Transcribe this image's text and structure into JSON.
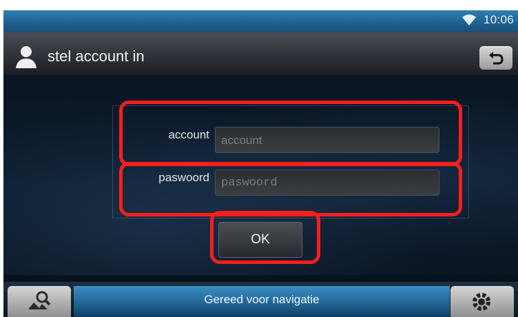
{
  "status": {
    "time": "10:06",
    "icon": "wifi-icon"
  },
  "header": {
    "title": "stel account in",
    "user_icon": "user-icon",
    "back_icon": "back-icon"
  },
  "form": {
    "account": {
      "label": "account",
      "placeholder": "account",
      "value": ""
    },
    "password": {
      "label": "paswoord",
      "placeholder": "paswoord",
      "value": ""
    },
    "ok_label": "OK"
  },
  "bottom": {
    "status_text": "Gereed voor navigatie",
    "left_icon": "map-search-icon",
    "right_icon": "settings-gear-icon"
  },
  "colors": {
    "highlight": "#ff1e1e",
    "statusbar": "#1f5f8e",
    "nav_strip": "#2a78ad"
  }
}
